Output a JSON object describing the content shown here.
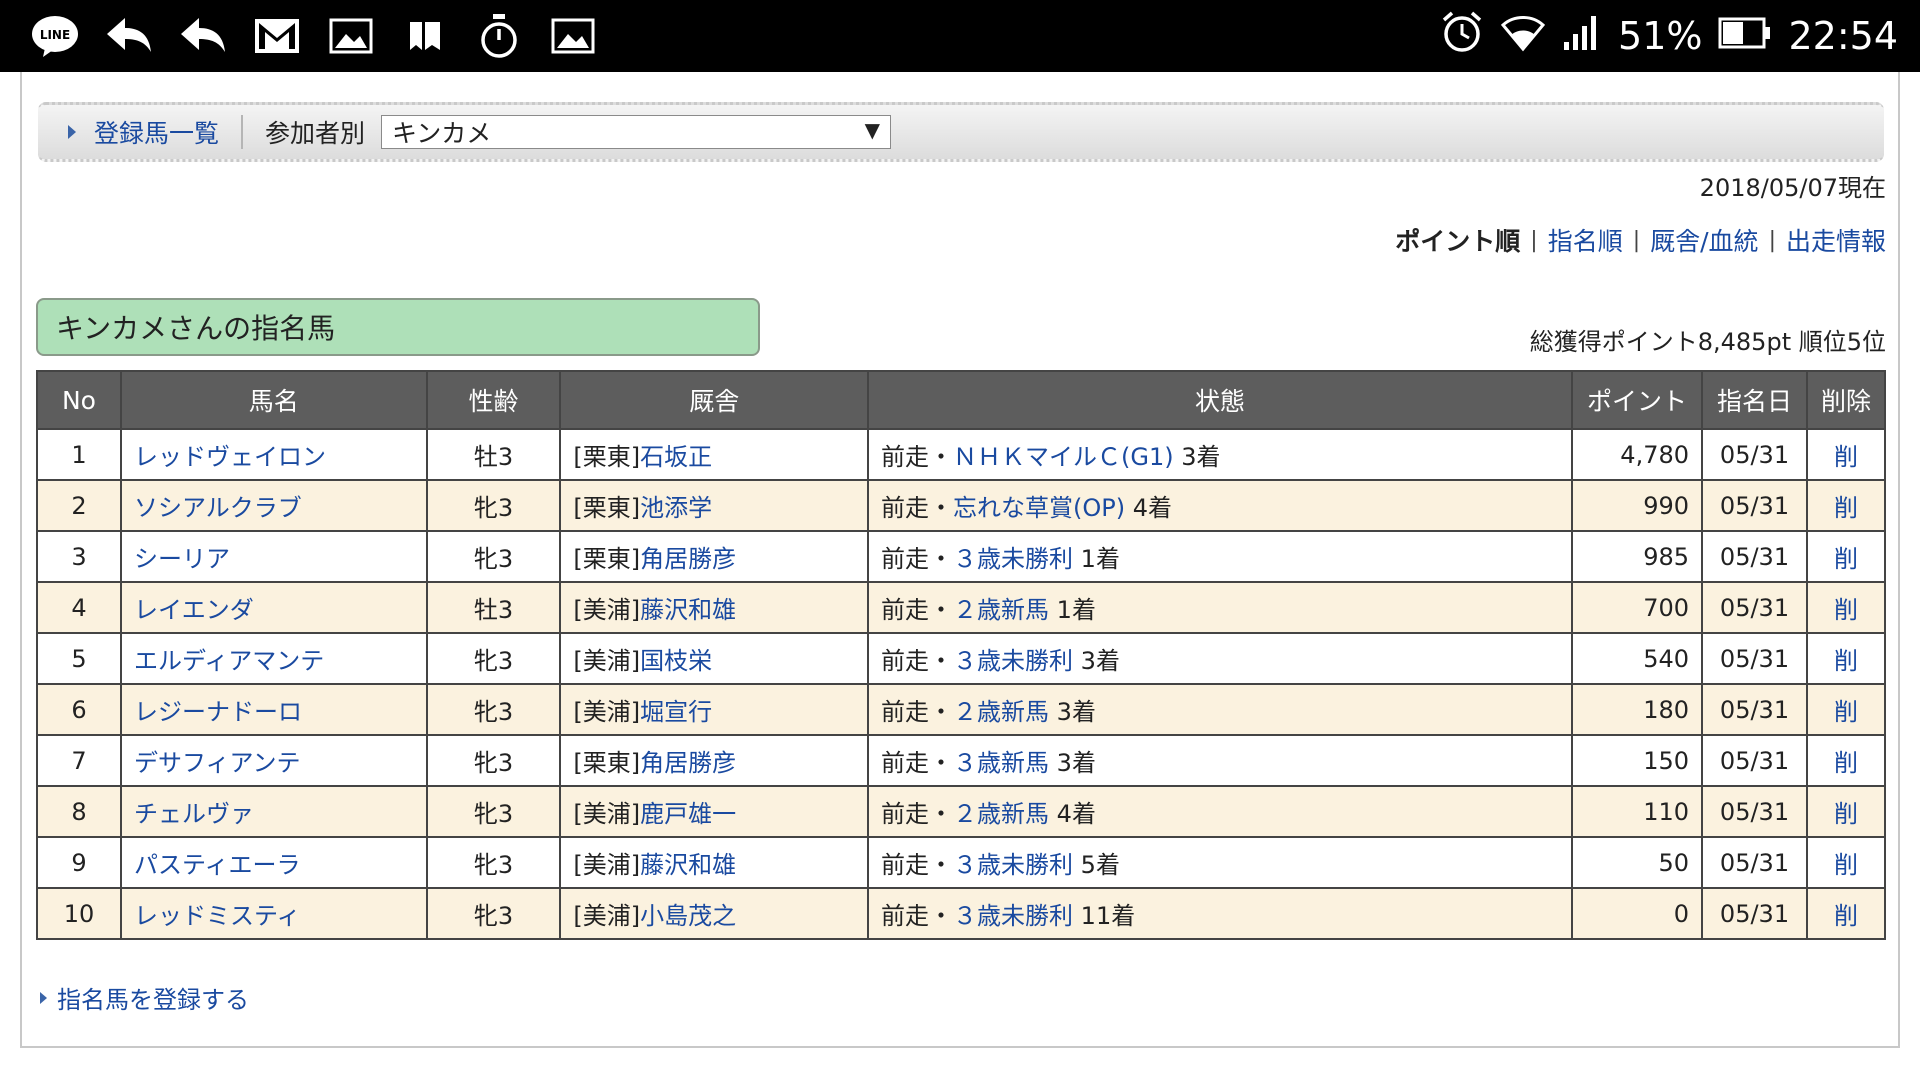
{
  "status_bar": {
    "icons": [
      "line-app-icon",
      "reply-icon",
      "reply-icon",
      "gmail-icon",
      "image-icon",
      "bookmark-icon",
      "stopwatch-icon",
      "image-icon"
    ],
    "battery": "51%",
    "time": "22:54"
  },
  "filter": {
    "list_link": "登録馬一覧",
    "by_participant_label": "参加者別",
    "selected_participant": "キンカメ"
  },
  "as_of": "2018/05/07現在",
  "sort": {
    "options": [
      "ポイント順",
      "指名順",
      "厩舎/血統",
      "出走情報"
    ],
    "active_index": 0
  },
  "section_title": "キンカメさんの指名馬",
  "summary": "総獲得ポイント8,485pt 順位5位",
  "table": {
    "headers": [
      "No",
      "馬名",
      "性齢",
      "厩舎",
      "状態",
      "ポイント",
      "指名日",
      "削除"
    ],
    "rows": [
      {
        "no": "1",
        "name": "レッドヴェイロン",
        "sex_age": "牡3",
        "stable_prefix": "[栗東]",
        "trainer": "石坂正",
        "status_prefix": "前走・",
        "race": "ＮＨＫマイルＣ(G1)",
        "finish": "3着",
        "points": "4,780",
        "date": "05/31",
        "del": "削"
      },
      {
        "no": "2",
        "name": "ソシアルクラブ",
        "sex_age": "牝3",
        "stable_prefix": "[栗東]",
        "trainer": "池添学",
        "status_prefix": "前走・",
        "race": "忘れな草賞(OP)",
        "finish": "4着",
        "points": "990",
        "date": "05/31",
        "del": "削"
      },
      {
        "no": "3",
        "name": "シーリア",
        "sex_age": "牝3",
        "stable_prefix": "[栗東]",
        "trainer": "角居勝彦",
        "status_prefix": "前走・",
        "race": "３歳未勝利",
        "finish": "1着",
        "points": "985",
        "date": "05/31",
        "del": "削"
      },
      {
        "no": "4",
        "name": "レイエンダ",
        "sex_age": "牡3",
        "stable_prefix": "[美浦]",
        "trainer": "藤沢和雄",
        "status_prefix": "前走・",
        "race": "２歳新馬",
        "finish": "1着",
        "points": "700",
        "date": "05/31",
        "del": "削"
      },
      {
        "no": "5",
        "name": "エルディアマンテ",
        "sex_age": "牝3",
        "stable_prefix": "[美浦]",
        "trainer": "国枝栄",
        "status_prefix": "前走・",
        "race": "３歳未勝利",
        "finish": "3着",
        "points": "540",
        "date": "05/31",
        "del": "削"
      },
      {
        "no": "6",
        "name": "レジーナドーロ",
        "sex_age": "牝3",
        "stable_prefix": "[美浦]",
        "trainer": "堀宣行",
        "status_prefix": "前走・",
        "race": "２歳新馬",
        "finish": "3着",
        "points": "180",
        "date": "05/31",
        "del": "削"
      },
      {
        "no": "7",
        "name": "デサフィアンテ",
        "sex_age": "牝3",
        "stable_prefix": "[栗東]",
        "trainer": "角居勝彦",
        "status_prefix": "前走・",
        "race": "３歳新馬",
        "finish": "3着",
        "points": "150",
        "date": "05/31",
        "del": "削"
      },
      {
        "no": "8",
        "name": "チェルヴァ",
        "sex_age": "牝3",
        "stable_prefix": "[美浦]",
        "trainer": "鹿戸雄一",
        "status_prefix": "前走・",
        "race": "２歳新馬",
        "finish": "4着",
        "points": "110",
        "date": "05/31",
        "del": "削"
      },
      {
        "no": "9",
        "name": "パスティエーラ",
        "sex_age": "牝3",
        "stable_prefix": "[美浦]",
        "trainer": "藤沢和雄",
        "status_prefix": "前走・",
        "race": "３歳未勝利",
        "finish": "5着",
        "points": "50",
        "date": "05/31",
        "del": "削"
      },
      {
        "no": "10",
        "name": "レッドミスティ",
        "sex_age": "牝3",
        "stable_prefix": "[美浦]",
        "trainer": "小島茂之",
        "status_prefix": "前走・",
        "race": "３歳未勝利",
        "finish": "11着",
        "points": "0",
        "date": "05/31",
        "del": "削"
      }
    ]
  },
  "register_link": "指名馬を登録する",
  "colors": {
    "link": "#1a4aa0",
    "header_bg": "#5d5d5d",
    "row_alt": "#fbf2df",
    "section_title_bg": "#aee0b8"
  }
}
